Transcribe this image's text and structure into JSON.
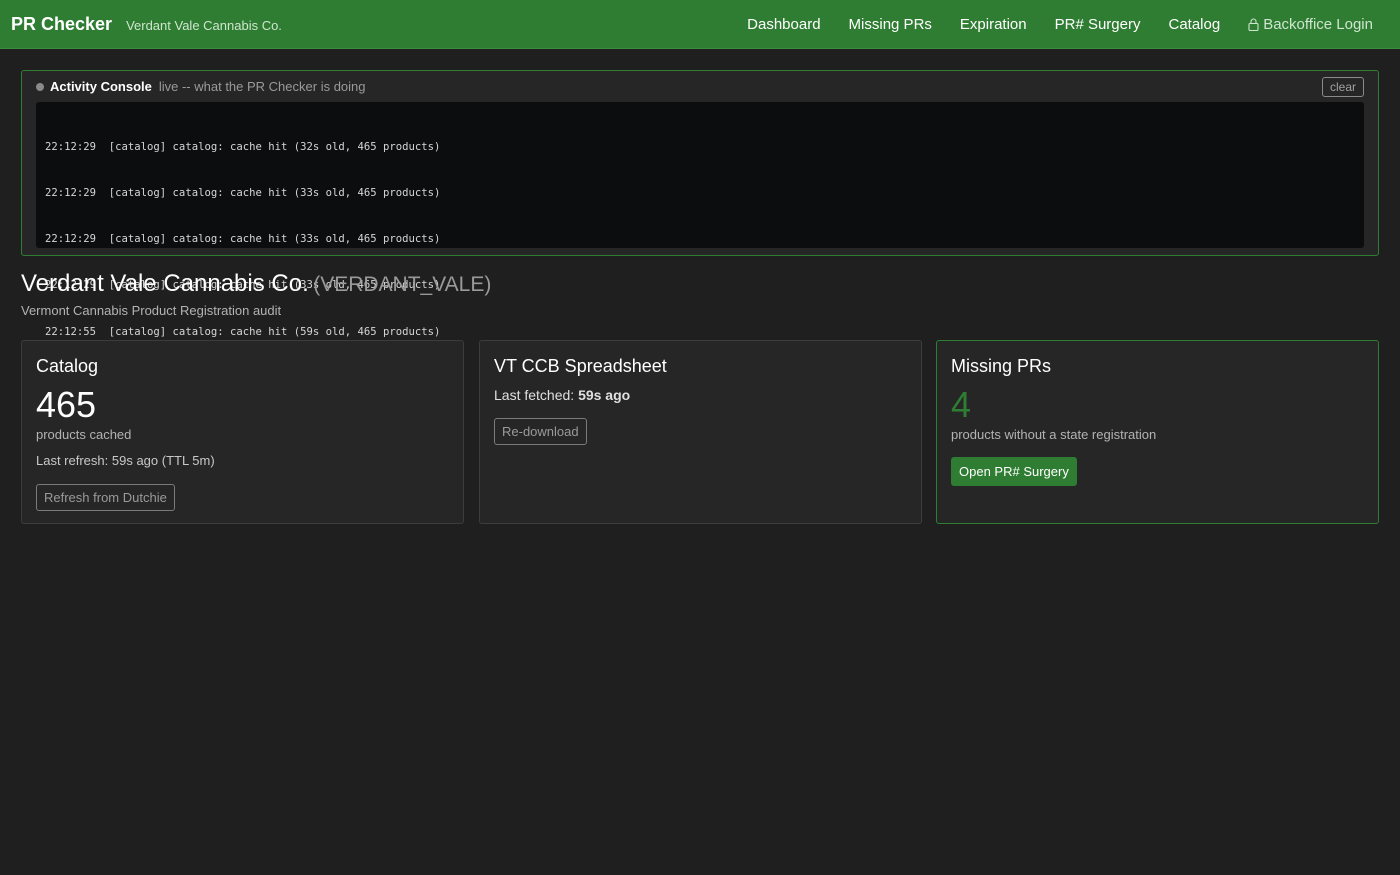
{
  "app": {
    "title": "PR Checker",
    "org_name": "Verdant Vale Cannabis Co."
  },
  "nav": {
    "items": [
      "Dashboard",
      "Missing PRs",
      "Expiration",
      "PR# Surgery",
      "Catalog"
    ],
    "login_label": "Backoffice Login",
    "login_icon": "lock-icon"
  },
  "console": {
    "title": "Activity Console",
    "subtitle": "live -- what the PR Checker is doing",
    "clear_label": "clear",
    "lines": [
      "22:12:29  [catalog] catalog: cache hit (32s old, 465 products)",
      "22:12:29  [catalog] catalog: cache hit (33s old, 465 products)",
      "22:12:29  [catalog] catalog: cache hit (33s old, 465 products)",
      "22:12:29  [catalog] catalog: cache hit (33s old, 465 products)",
      "22:12:55  [catalog] catalog: cache hit (59s old, 465 products)"
    ]
  },
  "org": {
    "name": "Verdant Vale Cannabis Co.",
    "code": "(VERDANT_VALE)",
    "subtitle": "Vermont Cannabis Product Registration audit"
  },
  "cards": {
    "catalog": {
      "title": "Catalog",
      "count": "465",
      "count_label": "products cached",
      "refresh_text": "Last refresh: 59s ago (TTL 5m)",
      "button": "Refresh from Dutchie"
    },
    "spreadsheet": {
      "title": "VT CCB Spreadsheet",
      "fetched_label": "Last fetched:",
      "fetched_value": "59s ago",
      "button": "Re-download"
    },
    "missing": {
      "title": "Missing PRs",
      "count": "4",
      "count_label": "products without a state registration",
      "button": "Open PR# Surgery"
    }
  },
  "colors": {
    "accent": "#2e7d32",
    "background": "#1f1f1f",
    "card": "#262626",
    "console_bg": "#0b0d0f"
  }
}
